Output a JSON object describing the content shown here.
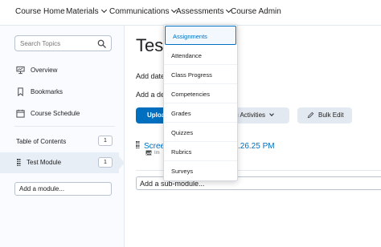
{
  "nav": {
    "items": [
      {
        "label": "Course Home",
        "has_menu": false
      },
      {
        "label": "Materials",
        "has_menu": true
      },
      {
        "label": "Communications",
        "has_menu": true
      },
      {
        "label": "Assessments",
        "has_menu": true
      },
      {
        "label": "Course Admin",
        "has_menu": false
      }
    ],
    "active": "Assessments"
  },
  "sidebar": {
    "search_placeholder": "Search Topics",
    "links": [
      {
        "label": "Overview",
        "icon": "overview-icon"
      },
      {
        "label": "Bookmarks",
        "icon": "bookmark-icon"
      },
      {
        "label": "Course Schedule",
        "icon": "calendar-icon"
      }
    ],
    "toc_label": "Table of Contents",
    "toc_count": "1",
    "module_label": "Test Module",
    "module_count": "1",
    "add_module_label": "Add a module..."
  },
  "main": {
    "title": "Test",
    "add_dates_text": "Add date",
    "add_desc_text": "Add a de",
    "upload_label": "Uploa",
    "activities_label": "ing Activities",
    "bulk_edit_label": "Bulk Edit",
    "item_title": "Scree",
    "item_time": ".26.25 PM",
    "item_sub": "Im",
    "add_submodule_label": "Add a sub-module..."
  },
  "dropdown": {
    "items": [
      "Assignments",
      "Attendance",
      "Class Progress",
      "Competencies",
      "Grades",
      "Quizzes",
      "Rubrics",
      "Surveys"
    ],
    "highlighted": "Assignments"
  },
  "colors": {
    "accent": "#006fbf",
    "sidebar_bg": "#f9fbff",
    "selected_row": "#e8eef6",
    "button_gray": "#e3e9f1"
  }
}
